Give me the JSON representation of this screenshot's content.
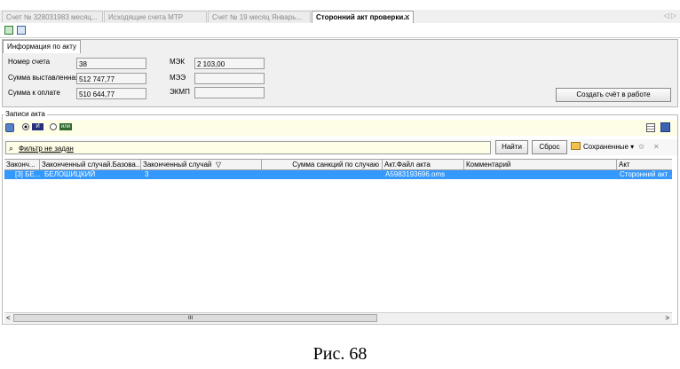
{
  "tabs": [
    {
      "label": "Счет № 328031983 месяц...",
      "active": false
    },
    {
      "label": "Исходящие счета МТР",
      "active": false
    },
    {
      "label": "Счет № 19 месяц Январь...",
      "active": false
    },
    {
      "label": "Сторонний акт проверки...",
      "active": true
    }
  ],
  "tab_close": "✕",
  "tab_nav": "◁ ▷",
  "info": {
    "subtab": "Информация по акту",
    "labels": {
      "nomer": "Номер счета",
      "summa_vyst": "Сумма выставленная",
      "summa_opl": "Сумма к оплате",
      "mek": "МЭК",
      "mee": "МЭЭ",
      "ekmp": "ЭКМП"
    },
    "values": {
      "nomer": "38",
      "summa_vyst": "512 747,77",
      "summa_opl": "510 644,77",
      "mek": "2 103,00",
      "mee": "",
      "ekmp": ""
    },
    "create_button": "Создать счёт в работе"
  },
  "records": {
    "legend": "Записи акта",
    "opt_and": "И",
    "opt_or": "или",
    "filter_label": "Фильтр не задан",
    "find_button": "Найти",
    "reset_button": "Сброс",
    "saved_label": "Сохраненные ▾",
    "close_glyph": "✕"
  },
  "grid": {
    "columns": [
      "Законч...",
      "Законченный случай.Базова...",
      "Законченный случай",
      "Сумма санкций по случаю",
      "Акт.Файл акта",
      "Комментарий",
      "Акт"
    ],
    "sort_glyph": "▽",
    "rows": [
      [
        "[3] БЕ...",
        "БЕЛОШИЦКИЙ",
        "3",
        "",
        "A5983193696.oms",
        "",
        "Сторонний акт ..."
      ]
    ],
    "scroll_left": "<",
    "scroll_right": ">",
    "scroll_grip": "III"
  },
  "caption": "Рис. 68",
  "colors": {
    "selection": "#3399ff",
    "panel": "#f0f0f0",
    "options_bg": "#fefde6"
  }
}
